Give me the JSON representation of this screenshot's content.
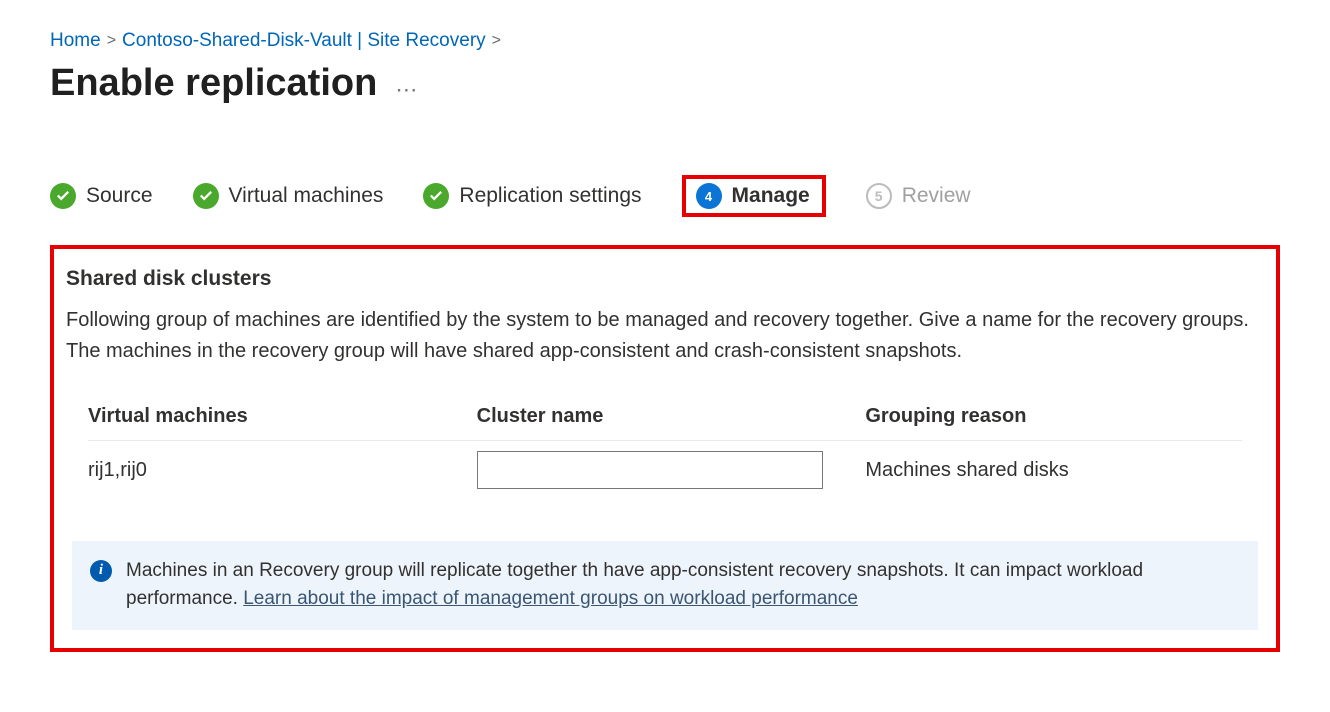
{
  "breadcrumb": {
    "home": "Home",
    "vault": "Contoso-Shared-Disk-Vault | Site Recovery"
  },
  "page_title": "Enable replication",
  "steps": [
    {
      "label": "Source",
      "state": "done"
    },
    {
      "label": "Virtual machines",
      "state": "done"
    },
    {
      "label": "Replication settings",
      "state": "done"
    },
    {
      "label": "Manage",
      "state": "current",
      "number": "4"
    },
    {
      "label": "Review",
      "state": "disabled",
      "number": "5"
    }
  ],
  "section": {
    "title": "Shared disk clusters",
    "description": "Following group of machines are identified by the system to be managed and recovery together. Give a name for the recovery groups. The machines in the recovery group will have shared app-consistent and crash-consistent snapshots."
  },
  "table": {
    "headers": {
      "vm": "Virtual machines",
      "cluster": "Cluster name",
      "reason": "Grouping reason"
    },
    "rows": [
      {
        "vm": "rij1,rij0",
        "cluster": "",
        "reason": "Machines shared disks"
      }
    ]
  },
  "info": {
    "text": "Machines in an Recovery group will replicate together th have app-consistent recovery snapshots. It can impact workload performance. ",
    "link": "Learn about the impact of management groups on workload performance"
  }
}
